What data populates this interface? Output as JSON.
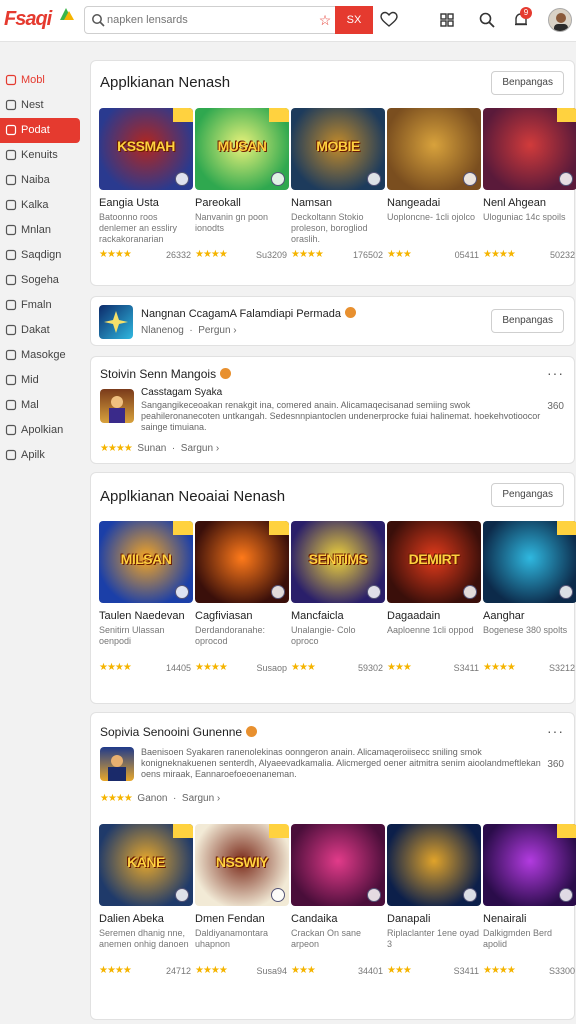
{
  "header": {
    "logo": "Fsaqi",
    "search_placeholder": "napken lensards",
    "search_button": "SX",
    "notif_count": "9"
  },
  "sidebar": {
    "items": [
      {
        "label": "Mobl",
        "icon": "power-icon",
        "state": "red"
      },
      {
        "label": "Nest",
        "icon": "doc-icon",
        "state": ""
      },
      {
        "label": "Podat",
        "icon": "pin-icon",
        "state": "active"
      },
      {
        "label": "Kenuits",
        "icon": "grid-icon",
        "state": ""
      },
      {
        "label": "Naiba",
        "icon": "folder-icon",
        "state": ""
      },
      {
        "label": "Kalka",
        "icon": "search-icon",
        "state": ""
      },
      {
        "label": "Mnlan",
        "icon": "pen-icon",
        "state": ""
      },
      {
        "label": "Saqdign",
        "icon": "image-icon",
        "state": ""
      },
      {
        "label": "Sogeha",
        "icon": "box-icon",
        "state": ""
      },
      {
        "label": "Fmaln",
        "icon": "cube-icon",
        "state": ""
      },
      {
        "label": "Dakat",
        "icon": "tag-icon",
        "state": ""
      },
      {
        "label": "Masokge",
        "icon": "chat-icon",
        "state": ""
      },
      {
        "label": "Mid",
        "icon": "list-icon",
        "state": ""
      },
      {
        "label": "Mal",
        "icon": "bolt-icon",
        "state": ""
      },
      {
        "label": "Apolkian",
        "icon": "star-icon",
        "state": ""
      },
      {
        "label": "Apilk",
        "icon": "clock-icon",
        "state": ""
      }
    ]
  },
  "section1": {
    "title": "Applkianan Nenash",
    "button": "Benpangas",
    "apps": [
      {
        "name": "Eangia Usta",
        "desc": "Batoonno roos denlemer an essliry rackakoranarian",
        "stars": "★★★★",
        "count": "26332",
        "art": "KSSMAH",
        "c1": "#2a3a8f",
        "c2": "#b3261e"
      },
      {
        "name": "Pareokall",
        "desc": "Nanvanin gn poon ionodts",
        "stars": "★★★★",
        "count": "Su3209",
        "art": "MUSAN",
        "c1": "#2fa84f",
        "c2": "#e9f27a"
      },
      {
        "name": "Namsan",
        "desc": "Deckoltann Stokio proleson, borogliod oraslih.",
        "stars": "★★★★",
        "count": "176502",
        "art": "MOBIE",
        "c1": "#1d3b5c",
        "c2": "#c38b2a"
      },
      {
        "name": "Nangeadai",
        "desc": "Uoploncne- 1cli ojolco",
        "stars": "★★★",
        "count": "05411",
        "art": "",
        "c1": "#7a4e1f",
        "c2": "#d8a23c"
      },
      {
        "name": "Nenl Ahgean",
        "desc": "Uloguniac 14c spoils",
        "stars": "★★★★",
        "count": "50232",
        "art": "",
        "c1": "#5a1a3a",
        "c2": "#d13b3b"
      }
    ]
  },
  "banner": {
    "title": "Nangnan CcagamA Falamdiapi Permada",
    "sub1": "Nlanenog",
    "sub2": "Pergun",
    "button": "Benpangas"
  },
  "feature1": {
    "title": "Stoivin Senn Mangois",
    "app_name": "Casstagam Syaka",
    "text": "Sangangikeceoakan renakgit ina, comered anain. Alicamaqecisanad semiing swok peahileronanecoten untkangah. Sedesnnpiantoclen undenerprocke fuiai halinemat. hoekehvotioocor sainge timuiana.",
    "rating": "Sunan",
    "more": "Sargun",
    "side_num": "360"
  },
  "section2": {
    "title": "Applkianan Neoaiai Nenash",
    "button": "Pengangas",
    "apps": [
      {
        "name": "Taulen Naedevan",
        "desc": "Senitirn Ulassan oenpodi",
        "stars": "★★★★",
        "count": "14405",
        "art": "MILSAN",
        "c1": "#1b3fa8",
        "c2": "#f5a623"
      },
      {
        "name": "Cagfiviasan",
        "desc": "Derdandoranahe: oprocod",
        "stars": "★★★★",
        "count": "Susaop",
        "art": "",
        "c1": "#3a0f0a",
        "c2": "#ff7a1a"
      },
      {
        "name": "Mancfaicla",
        "desc": "Unalangie- Colo oproco",
        "stars": "★★★",
        "count": "59302",
        "art": "SENTIMS",
        "c1": "#2a1f6a",
        "c2": "#f0d33a"
      },
      {
        "name": "Dagaadain",
        "desc": "Aaploenne 1cli oppod",
        "stars": "★★★",
        "count": "S3411",
        "art": "DEMIRT",
        "c1": "#3a0f0a",
        "c2": "#e23b1b"
      },
      {
        "name": "Aanghar",
        "desc": "Bogenese 380 spolts",
        "stars": "★★★★",
        "count": "S3212",
        "art": "",
        "c1": "#0c2a4a",
        "c2": "#2fb8e0"
      }
    ]
  },
  "feature2": {
    "title": "Sopivia Senooini Gunenne",
    "text": "Baenisoen Syakaren ranenolekinas oonngeron anain. Alicamaqeroiisecc sniling smok konigneknakuenen senterdh, Alyaeevadkamalia. Alicmerged oener aitmitra senim aioolandmeftlekan oens miraak, Eannaroefoeoenaneman.",
    "rating": "Ganon",
    "more": "Sargun",
    "side_num": "360"
  },
  "section3": {
    "apps": [
      {
        "name": "Dalien Abeka",
        "desc": "Seremen dhanig nne, anemen onhig danoen",
        "stars": "★★★★",
        "count": "24712",
        "art": "KANE",
        "c1": "#1f3a6a",
        "c2": "#e8a82b"
      },
      {
        "name": "Dmen Fendan",
        "desc": "Daldiyanamontara uhapnon",
        "stars": "★★★★",
        "count": "Susa94",
        "art": "NSSWIY",
        "c1": "#f2ead6",
        "c2": "#7a2a1a"
      },
      {
        "name": "Candaika",
        "desc": "Crackan On sane arpeon",
        "stars": "★★★",
        "count": "34401",
        "art": "",
        "c1": "#4a0e3a",
        "c2": "#e23b8a"
      },
      {
        "name": "Danapali",
        "desc": "Riplaclanter 1ene oyad 3",
        "stars": "★★★",
        "count": "S3411",
        "art": "",
        "c1": "#0c1f4a",
        "c2": "#e0a32a"
      },
      {
        "name": "Nenairali",
        "desc": "Dalkigmden Berd apolid",
        "stars": "★★★★",
        "count": "S3300",
        "art": "",
        "c1": "#2a0c4a",
        "c2": "#b23be0"
      }
    ]
  },
  "colors": {
    "accent": "#e53a2f",
    "star": "#f5b400"
  }
}
